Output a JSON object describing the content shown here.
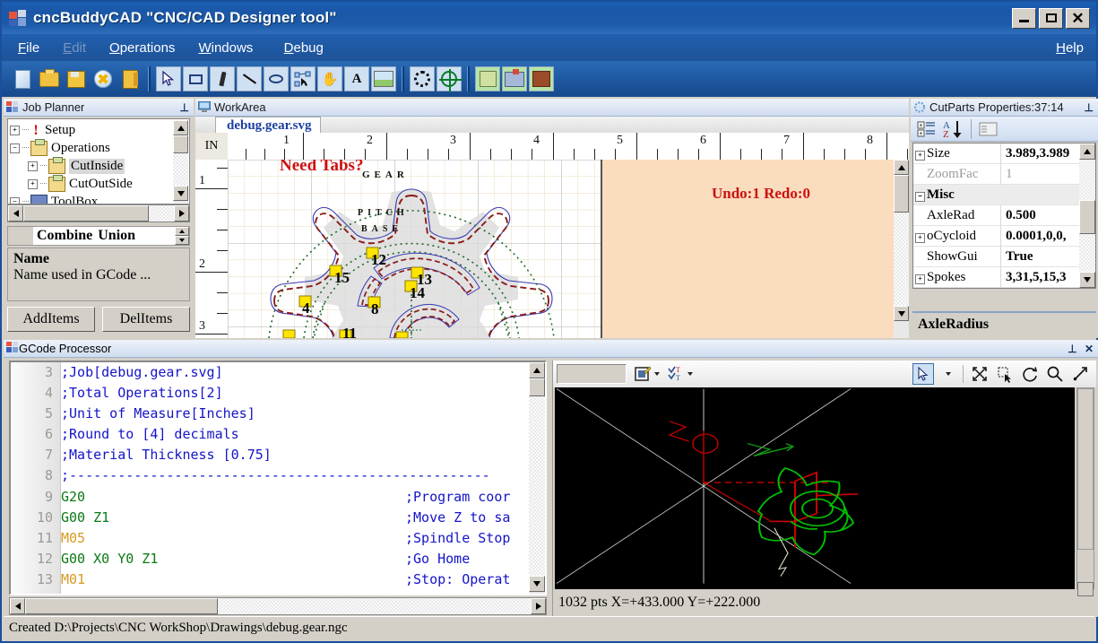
{
  "window": {
    "title": "cncBuddyCAD \"CNC/CAD Designer tool\"",
    "minimize": "_",
    "maximize": "□",
    "close": "✕"
  },
  "menu": {
    "items": [
      {
        "label": "File",
        "accel": "F",
        "disabled": false
      },
      {
        "label": "Edit",
        "accel": "E",
        "disabled": true
      },
      {
        "label": "Operations",
        "accel": "O",
        "disabled": false
      },
      {
        "label": "Windows",
        "accel": "W",
        "disabled": false
      },
      {
        "label": "Debug",
        "accel": "D",
        "disabled": false
      }
    ],
    "help": "Help"
  },
  "toolbar": {
    "groups": [
      [
        "new-document-icon",
        "open-folder-icon",
        "save-icon",
        "close-document-icon",
        "exit-icon"
      ],
      [
        "select-arrow-icon",
        "rectangle-tool-icon",
        "pen-tool-icon",
        "line-tool-icon",
        "ellipse-tool-icon",
        "node-edit-icon",
        "pan-hand-icon",
        "text-tool-icon",
        "image-tool-icon"
      ],
      [
        "gear-generator-icon",
        "target-center-icon"
      ],
      [
        "nest-parts-icon",
        "machine-icon",
        "toolbox-icon"
      ]
    ]
  },
  "job_planner": {
    "title": "Job Planner",
    "pin": "⊥",
    "tree": [
      {
        "label": "Setup",
        "expander": "+",
        "icon": "warning-icon",
        "indent": 0,
        "selected": false
      },
      {
        "label": "Operations",
        "expander": "−",
        "icon": "operations-icon",
        "indent": 0,
        "selected": false
      },
      {
        "label": "CutInside",
        "expander": "+",
        "icon": "operation-icon",
        "indent": 1,
        "selected": true
      },
      {
        "label": "CutOutSide",
        "expander": "+",
        "icon": "operation-icon",
        "indent": 1,
        "selected": false
      },
      {
        "label": "ToolBox",
        "expander": "−",
        "icon": "toolbox-icon",
        "indent": 0,
        "selected": false
      }
    ],
    "combine": {
      "property": "Combine",
      "value": "Union"
    },
    "description": {
      "name": "Name",
      "text": "Name used in GCode ..."
    },
    "buttons": {
      "add": "AddItems",
      "del": "DelItems"
    }
  },
  "work_area": {
    "title": "WorkArea",
    "tab": "debug.gear.svg",
    "unit": "IN",
    "ruler_h": [
      "1",
      "2",
      "3",
      "4",
      "5",
      "6",
      "7",
      "8"
    ],
    "ruler_v": [
      "1",
      "2",
      "3"
    ],
    "overlay_text": "Need Tabs?",
    "undo_redo": "Undo:1 Redo:0",
    "drawing_labels": [
      "GEAR",
      "PITCH",
      "BASE"
    ],
    "tab_markers": [
      "12",
      "15",
      "13",
      "14",
      "4",
      "8",
      "11"
    ],
    "colors": {
      "outline": "#3a3ab4",
      "cut_path": "#8b1a1a",
      "guide": "#1d6b2a",
      "marker": "#ffe400",
      "overlay": "#cc1111",
      "offsheet": "#fadcbe"
    }
  },
  "properties": {
    "title": "CutParts Properties:37:14",
    "pin": "⊥",
    "toolbar": [
      "categorized-icon",
      "alphabetic-sort-icon",
      "property-pages-icon"
    ],
    "rows": [
      {
        "expander": "+",
        "name": "Size",
        "value": "3.989,3.989",
        "category": false,
        "dim": false
      },
      {
        "expander": "",
        "name": "ZoomFac",
        "value": "1",
        "category": false,
        "dim": true
      },
      {
        "expander": "−",
        "name": "Misc",
        "value": "",
        "category": true,
        "dim": false
      },
      {
        "expander": "",
        "name": "AxleRad",
        "value": "0.500",
        "category": false,
        "dim": false
      },
      {
        "expander": "+",
        "name": "oCycloid",
        "value": "0.0001,0,0,",
        "category": false,
        "dim": false
      },
      {
        "expander": "",
        "name": "ShowGui",
        "value": "True",
        "category": false,
        "dim": false
      },
      {
        "expander": "+",
        "name": "Spokes",
        "value": "3,31,5,15,3",
        "category": false,
        "dim": false
      }
    ],
    "footer": "AxleRadius"
  },
  "gcode": {
    "title": "GCode Processor",
    "pin": "⊥",
    "close": "✕",
    "lines": [
      {
        "num": "3",
        "code": ";Job[debug.gear.svg]",
        "type": "comment",
        "inline": ""
      },
      {
        "num": "4",
        "code": ";Total Operations[2]",
        "type": "comment",
        "inline": ""
      },
      {
        "num": "5",
        "code": ";Unit of Measure[Inches]",
        "type": "comment",
        "inline": ""
      },
      {
        "num": "6",
        "code": ";Round to [4] decimals",
        "type": "comment",
        "inline": ""
      },
      {
        "num": "7",
        "code": ";Material Thickness [0.75]",
        "type": "comment",
        "inline": ""
      },
      {
        "num": "8",
        "code": ";----------------------------------------------------",
        "type": "comment",
        "inline": ""
      },
      {
        "num": "9",
        "code": "G20",
        "type": "g",
        "inline": ";Program coor"
      },
      {
        "num": "10",
        "code": "G00 Z1",
        "type": "g",
        "inline": ";Move Z to sa"
      },
      {
        "num": "11",
        "code": "M05",
        "type": "m",
        "inline": ";Spindle Stop"
      },
      {
        "num": "12",
        "code": "G00 X0 Y0 Z1",
        "type": "g",
        "inline": ";Go Home"
      },
      {
        "num": "13",
        "code": "M01",
        "type": "m",
        "inline": ";Stop: Operat"
      }
    ]
  },
  "preview": {
    "combo_value": "",
    "toolbar": [
      "edit-properties-icon",
      "sort-text-icon",
      "select-pointer-icon",
      "fit-icon",
      "zoom-window-icon",
      "rotate-icon",
      "zoom-icon",
      "measure-icon"
    ],
    "status": "1032 pts  X=+433.000 Y=+222.000",
    "colors": {
      "background": "#000000",
      "toolpath": "#00c000",
      "rapid": "#cc0000",
      "axis": "#c8c8c8"
    }
  },
  "statusbar": {
    "text": "Created D:\\Projects\\CNC WorkShop\\Drawings\\debug.gear.ngc"
  }
}
